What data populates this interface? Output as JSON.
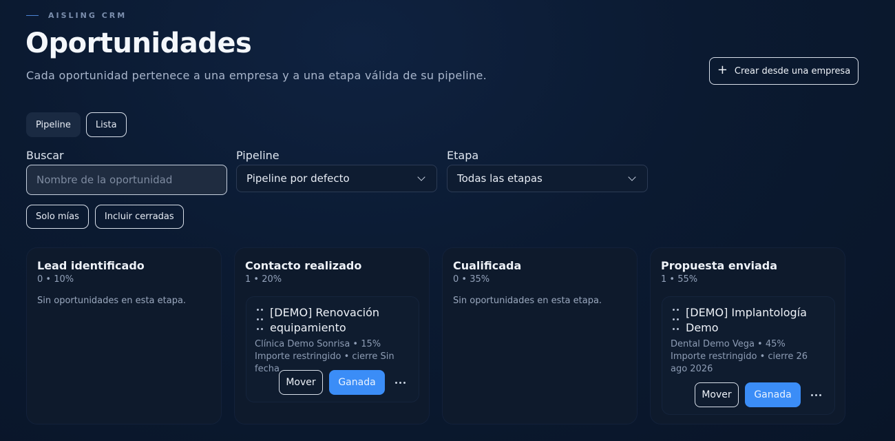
{
  "brand": "AISLING CRM",
  "header": {
    "title": "Oportunidades",
    "subtitle": "Cada oportunidad pertenece a una empresa y a una etapa válida de su pipeline.",
    "create_button": "Crear desde una empresa"
  },
  "views": {
    "pipeline": "Pipeline",
    "list": "Lista"
  },
  "filters": {
    "search_label": "Buscar",
    "search_placeholder": "Nombre de la oportunidad",
    "pipeline_label": "Pipeline",
    "pipeline_value": "Pipeline por defecto",
    "stage_label": "Etapa",
    "stage_value": "Todas las etapas",
    "only_mine": "Solo mías",
    "include_closed": "Incluir cerradas"
  },
  "columns": [
    {
      "title": "Lead identificado",
      "meta": "0 • 10%",
      "empty": "Sin oportunidades en esta etapa."
    },
    {
      "title": "Contacto realizado",
      "meta": "1 • 20%",
      "card": {
        "title": "[DEMO] Renovación equipamiento",
        "company": "Clínica Demo Sonrisa • 15%",
        "detail": "Importe restringido • cierre Sin fecha",
        "move": "Mover",
        "won": "Ganada"
      }
    },
    {
      "title": "Cualificada",
      "meta": "0 • 35%",
      "empty": "Sin oportunidades en esta etapa."
    },
    {
      "title": "Propuesta enviada",
      "meta": "1 • 55%",
      "card": {
        "title": "[DEMO] Implantología Demo",
        "company": "Dental Demo Vega • 45%",
        "detail": "Importe restringido • cierre 26 ago 2026",
        "move": "Mover",
        "won": "Ganada"
      }
    }
  ]
}
